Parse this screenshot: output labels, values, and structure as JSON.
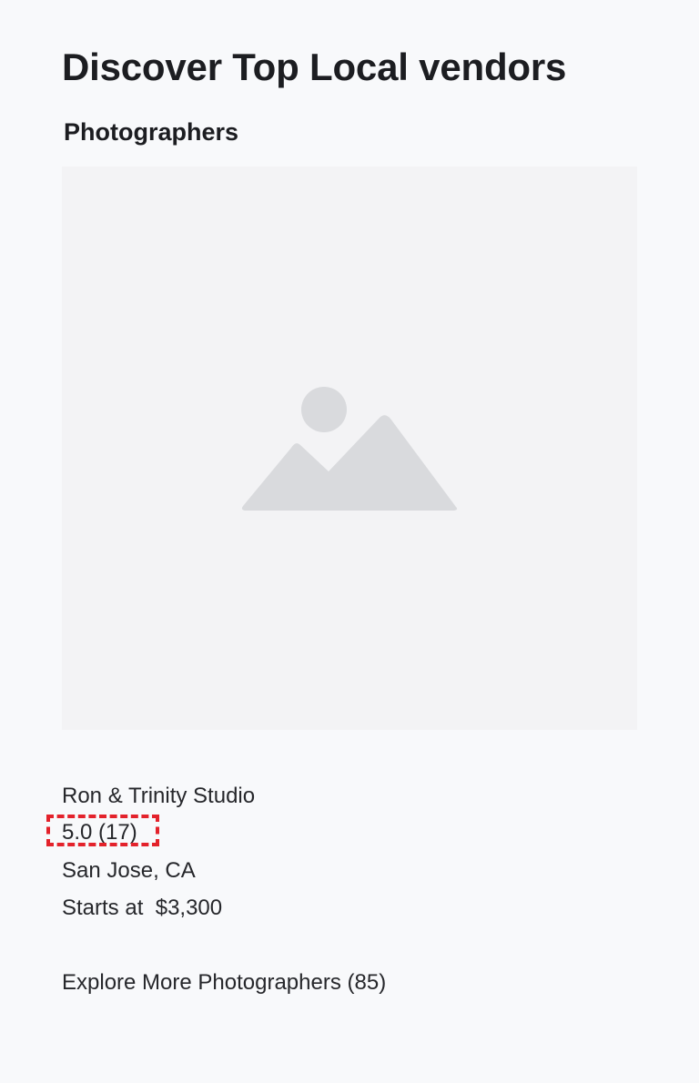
{
  "header": {
    "title": "Discover Top Local vendors"
  },
  "section": {
    "heading": "Photographers"
  },
  "vendor": {
    "image_icon": "image-placeholder-icon",
    "name": "Ron & Trinity Studio",
    "rating": "5.0",
    "review_count": "(17)",
    "location": "San  Jose, CA",
    "price_label": "Starts at",
    "price": "$3,300"
  },
  "footer": {
    "explore_label": "Explore More Photographers (85)"
  },
  "colors": {
    "background": "#f8f9fb",
    "image_placeholder": "#f3f3f5",
    "placeholder_icon": "#d9dadd",
    "highlight": "#e3222b"
  }
}
